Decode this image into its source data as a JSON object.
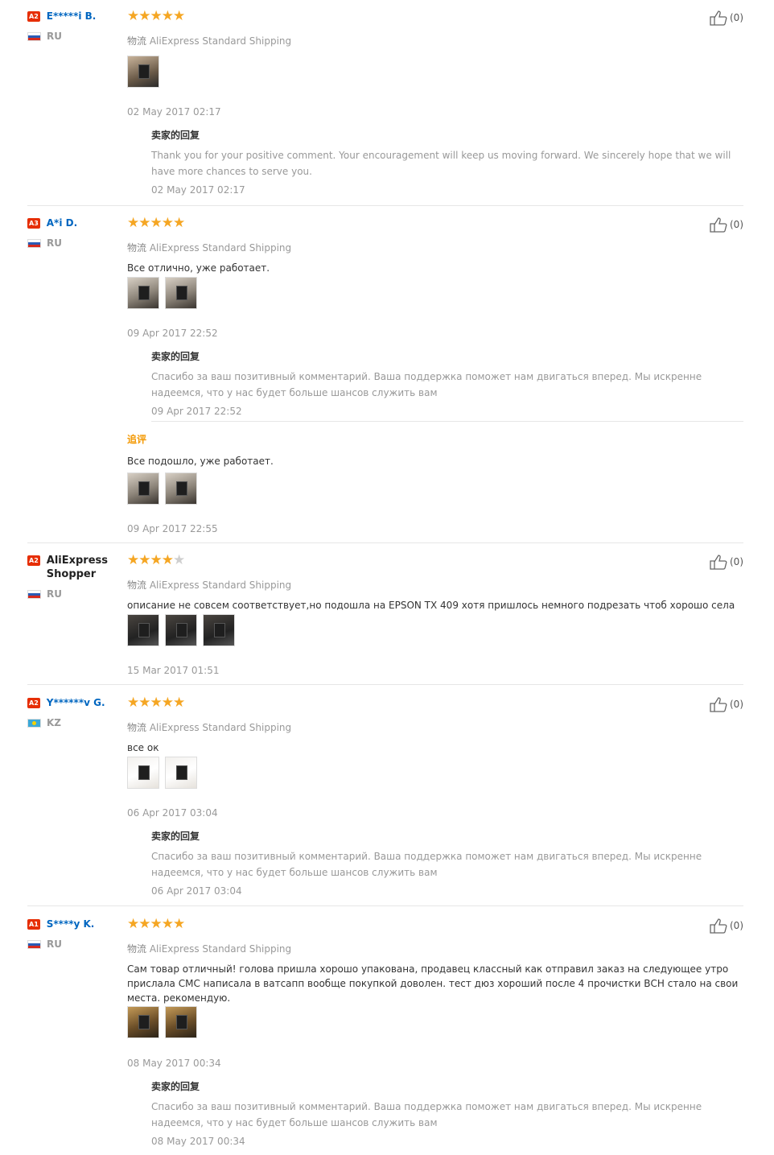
{
  "reviews": [
    {
      "level": "A2",
      "name": "E*****i B.",
      "country": "RU",
      "flag": "ru",
      "stars": 5,
      "logistics_label": "物流",
      "shipping": "AliExpress Standard Shipping",
      "text": "",
      "images": [
        "t1"
      ],
      "date": "02 May 2017 02:17",
      "reply": {
        "title": "卖家的回复",
        "text": "Thank you for your positive comment. Your encouragement will keep us moving forward. We sincerely hope that we will have more chances to serve you.",
        "date": "02 May 2017 02:17"
      },
      "likes": "(0)"
    },
    {
      "level": "A3",
      "name": "A*i D.",
      "country": "RU",
      "flag": "ru",
      "stars": 5,
      "logistics_label": "物流",
      "shipping": "AliExpress Standard Shipping",
      "text": "Все отлично, уже работает.",
      "images": [
        "t2",
        "t2"
      ],
      "date": "09 Apr 2017 22:52",
      "reply": {
        "title": "卖家的回复",
        "text": "Спасибо за ваш позитивный комментарий. Ваша поддержка поможет нам двигаться вперед. Мы искренне надеемся, что у нас будет больше шансов служить вам",
        "date": "09 Apr 2017 22:52"
      },
      "additional": {
        "title": "追评",
        "text": "Все подошло, уже работает.",
        "images": [
          "t2",
          "t2"
        ],
        "date": "09 Apr 2017 22:55"
      },
      "likes": "(0)"
    },
    {
      "level": "A2",
      "name": "AliExpress Shopper",
      "country": "RU",
      "flag": "ru",
      "stars": 4,
      "logistics_label": "物流",
      "shipping": "AliExpress Standard Shipping",
      "text": "описание не совсем соответствует,но подошла на EPSON TX 409 хотя пришлось немного подрезать чтоб хорошо села",
      "images": [
        "t3",
        "t3",
        "t3"
      ],
      "date": "15 Mar 2017 01:51",
      "likes": "(0)"
    },
    {
      "level": "A2",
      "name": "Y******v G.",
      "country": "KZ",
      "flag": "kz",
      "stars": 5,
      "logistics_label": "物流",
      "shipping": "AliExpress Standard Shipping",
      "text": "все ок",
      "images": [
        "t4",
        "t4"
      ],
      "date": "06 Apr 2017 03:04",
      "reply": {
        "title": "卖家的回复",
        "text": "Спасибо за ваш позитивный комментарий. Ваша поддержка поможет нам двигаться вперед. Мы искренне надеемся, что у нас будет больше шансов служить вам",
        "date": "06 Apr 2017 03:04"
      },
      "likes": "(0)"
    },
    {
      "level": "A1",
      "name": "S****y K.",
      "country": "RU",
      "flag": "ru",
      "stars": 5,
      "logistics_label": "物流",
      "shipping": "AliExpress Standard Shipping",
      "text": "Сам товар отличный! голова пришла хорошо упакована, продавец классный как отправил заказ на следующее утро прислала СМС написала в ватсапп вообще покупкой доволен. тест дюз хороший после 4 прочистки ВСН стало на свои места. рекомендую.",
      "images": [
        "t5",
        "t5"
      ],
      "date": "08 May 2017 00:34",
      "reply": {
        "title": "卖家的回复",
        "text": "Спасибо за ваш позитивный комментарий. Ваша поддержка поможет нам двигаться вперед. Мы искренне надеемся, что у нас будет больше шансов служить вам",
        "date": "08 May 2017 00:34"
      },
      "likes": "(0)"
    }
  ]
}
